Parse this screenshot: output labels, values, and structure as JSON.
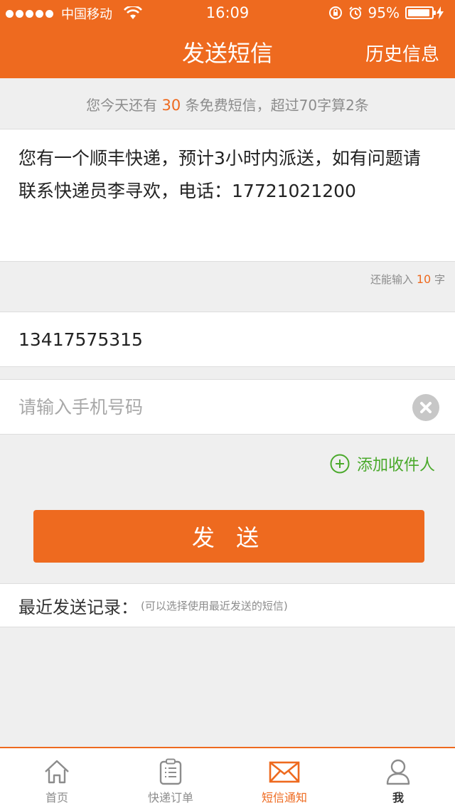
{
  "status_bar": {
    "carrier": "中国移动",
    "time": "16:09",
    "battery": "95%"
  },
  "nav": {
    "title": "发送短信",
    "history": "历史信息"
  },
  "quota": {
    "prefix": "您今天还有",
    "count": "30",
    "suffix": "条免费短信，超过70字算2条"
  },
  "message": {
    "text": "您有一个顺丰快递，预计3小时内派送，如有问题请联系快递员李寻欢，电话：17721021200"
  },
  "remaining": {
    "prefix": "还能输入",
    "count": "10",
    "suffix": "字"
  },
  "recipients": {
    "phone1": "13417575315",
    "phone2_placeholder": "请输入手机号码"
  },
  "add_recipient": "添加收件人",
  "send_label": "发 送",
  "recent": {
    "title": "最近发送记录：",
    "hint": "(可以选择使用最近发送的短信)"
  },
  "tabs": [
    {
      "label": "首页",
      "icon": "home-icon"
    },
    {
      "label": "快递订单",
      "icon": "clipboard-icon"
    },
    {
      "label": "短信通知",
      "icon": "envelope-icon"
    },
    {
      "label": "我",
      "icon": "user-icon"
    }
  ],
  "colors": {
    "accent": "#ee6a1f",
    "green": "#4aa92b"
  }
}
